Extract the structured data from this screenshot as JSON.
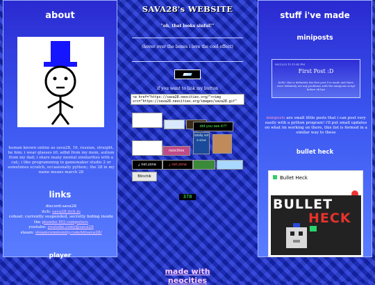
{
  "left": {
    "about_title": "about",
    "about_text": "human known online as sava28, 16, russian, straight, he him; i wear glasses irl; adhd from my mom, autism from my dad; i share many mental similarities with a cat;; i like programming in gamemaker studio 2 or sometimes scratch, occasionally python;; the 28 in my name means march 28",
    "links_title": "links",
    "links": [
      {
        "label": "discord:",
        "value": "sava28"
      },
      {
        "label": "itch:",
        "value": "sava28.itch.io"
      },
      {
        "label": "cohost: currently suspended, secretly hiding inside the",
        "value": "plumbo HQ computers"
      },
      {
        "label": "youtube:",
        "value": "youtube.com/@sava28"
      },
      {
        "label": "steam:",
        "value": "steamcommunity.com/id/sava28/"
      }
    ],
    "player_title": "player"
  },
  "center": {
    "site_title": "SAVA28's WEBSITE",
    "tagline": "\"oh, that looks sinful!\"",
    "hover_note": "(hover over the boxes i love the cool effect)",
    "link_note": "if you want to link my button",
    "code_line1": "<a href=\"https://sava28.neocities.org/\"><img",
    "code_line2": "src=\"https://sava28.neocities.org/images/sava28.gif\"",
    "buttons": [
      {
        "name": "button-placeholder",
        "text": "",
        "bg": "#ffffff",
        "fg": "#000000"
      },
      {
        "name": "button-arrow",
        "text": "",
        "bg": "#d8e8ff",
        "fg": "#000000"
      },
      {
        "name": "button-dark-banner",
        "text": "",
        "bg": "#3a2a1a",
        "fg": "#ffffff"
      },
      {
        "name": "button-did-you-see-it",
        "text": "did you see it??",
        "bg": "#000000",
        "fg": "#55ff55"
      },
      {
        "name": "button-face",
        "text": "",
        "bg": "#ffffff",
        "fg": "#000000"
      },
      {
        "name": "button-neocities",
        "text": "neocities",
        "bg": "#c04a8a",
        "fg": "#ffffff"
      },
      {
        "name": "button-cyan-blob",
        "text": "totally not a virus",
        "bg": "#1a4a9a",
        "fg": "#ffffff"
      },
      {
        "name": "button-dog",
        "text": "",
        "bg": "#c08a5a",
        "fg": "#000000"
      },
      {
        "name": "button-zone-1",
        "text": "¿ net.zone",
        "bg": "#000000",
        "fg": "#ffffff"
      },
      {
        "name": "button-zone-2",
        "text": "¿ net.zone",
        "bg": "#000000",
        "fg": "#ff6060"
      },
      {
        "name": "button-colorful",
        "text": "",
        "bg": "#3a8a3a",
        "fg": "#ffffff"
      },
      {
        "name": "button-light-blue",
        "text": "",
        "bg": "#a8d8ff",
        "fg": "#000000"
      },
      {
        "name": "button-blinchik",
        "text": "Blinchik",
        "bg": "#e8e8e8",
        "fg": "#000000"
      }
    ],
    "counter": "378",
    "footer_link": "made with neocities"
  },
  "right": {
    "stuff_title": "stuff i've made",
    "miniposts_title": "miniposts",
    "mini_date": "06/12/23 11:11:45 PM",
    "mini_post_title": "First Post :D",
    "mini_post_body": "hello! this is definitely the first post I've made and there were definitely not any problems with the miniposts script before ok bye",
    "mini_desc_link": "miniposts",
    "mini_desc": " are small little posts that i can post very easily with a python program! i'll put small updates on what im working on there, this list is formed in a similar way to these",
    "bullet_heck_title": "bullet heck",
    "bh_header": "Bullet Heck",
    "bh_word1": "BULLET",
    "bh_word2": "HECK"
  }
}
